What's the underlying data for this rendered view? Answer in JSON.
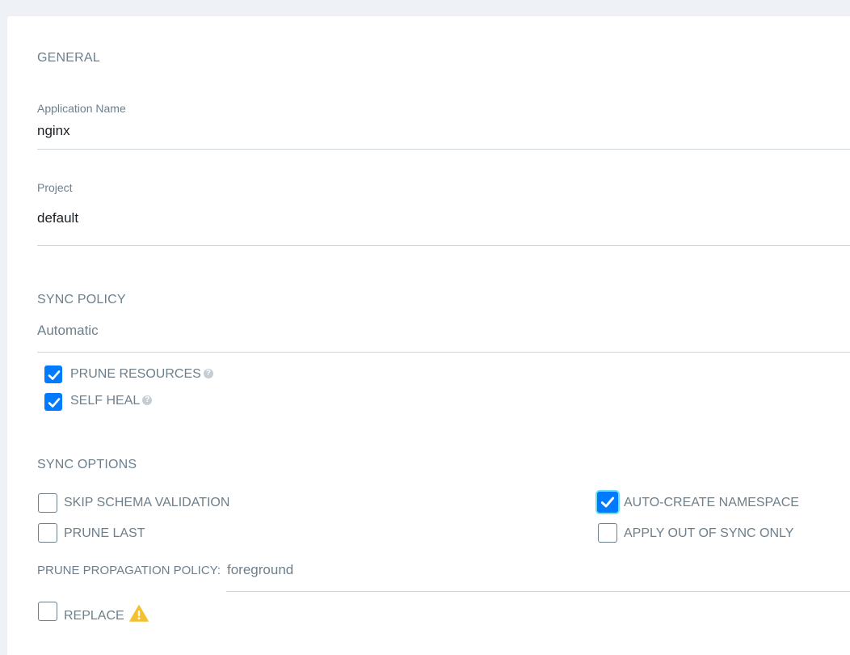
{
  "general": {
    "section_title": "GENERAL",
    "app_name_label": "Application Name",
    "app_name_value": "nginx",
    "project_label": "Project",
    "project_value": "default"
  },
  "sync_policy": {
    "section_title": "SYNC POLICY",
    "value": "Automatic",
    "options": [
      {
        "label": "PRUNE RESOURCES",
        "checked": true
      },
      {
        "label": "SELF HEAL",
        "checked": true
      }
    ]
  },
  "sync_options": {
    "section_title": "SYNC OPTIONS",
    "skip_schema_validation": {
      "label": "SKIP SCHEMA VALIDATION",
      "checked": false
    },
    "prune_last": {
      "label": "PRUNE LAST",
      "checked": false
    },
    "auto_create_namespace": {
      "label": "AUTO-CREATE NAMESPACE",
      "checked": true
    },
    "apply_out_of_sync_only": {
      "label": "APPLY OUT OF SYNC ONLY",
      "checked": false
    },
    "prune_propagation_label": "PRUNE PROPAGATION POLICY:",
    "prune_propagation_value": "foreground",
    "replace": {
      "label": "REPLACE",
      "checked": false
    }
  },
  "colors": {
    "accent": "#007bff",
    "warning": "#f4c030",
    "focus_ring": "#6ee0f5"
  }
}
